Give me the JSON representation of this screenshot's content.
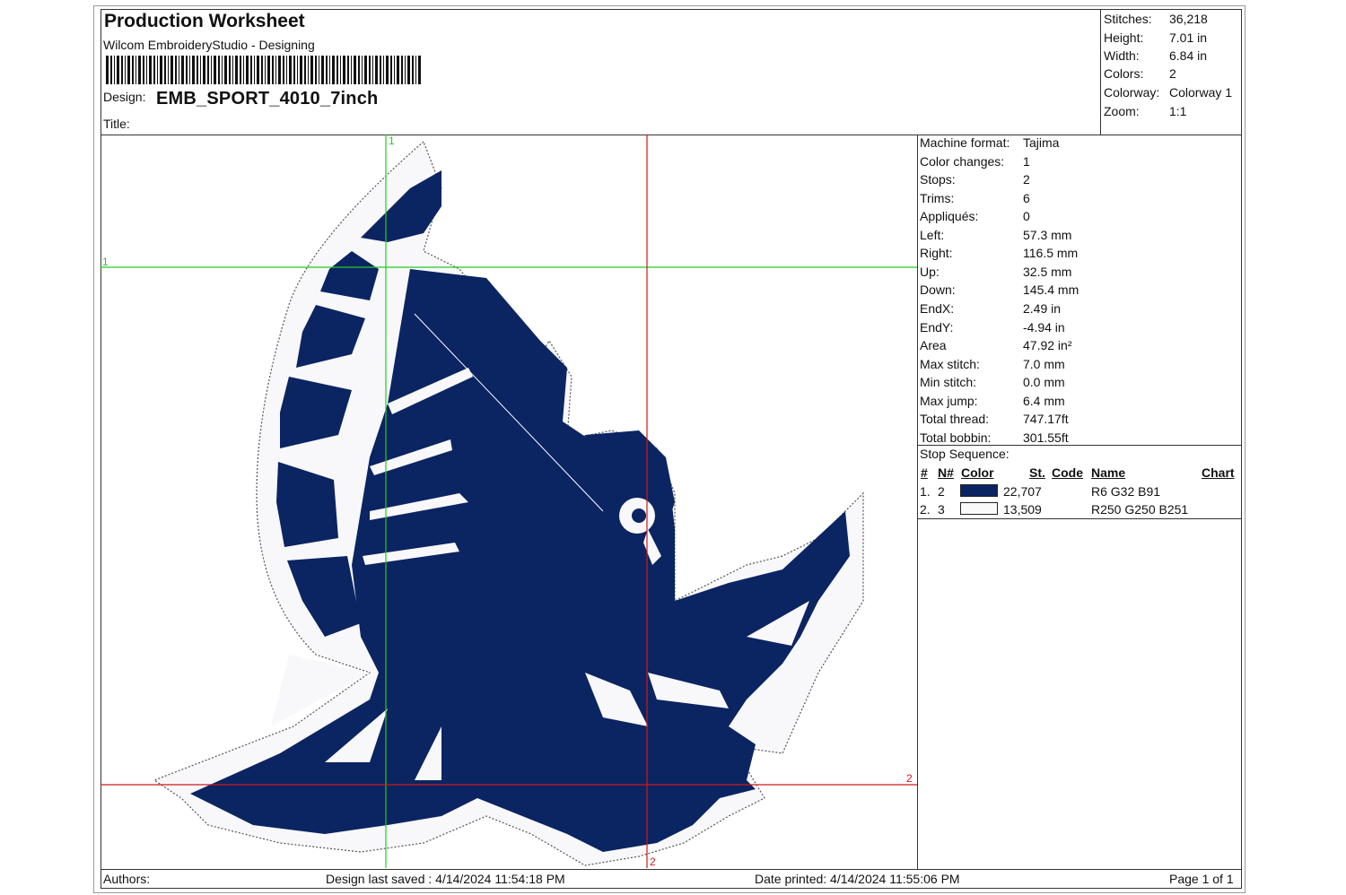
{
  "header": {
    "title": "Production Worksheet",
    "subtitle": "Wilcom EmbroideryStudio - Designing",
    "design_label": "Design:",
    "design_name": "EMB_SPORT_4010_7inch",
    "title_label": "Title:"
  },
  "summary": [
    {
      "k": "Stitches:",
      "v": "36,218"
    },
    {
      "k": "Height:",
      "v": "7.01 in"
    },
    {
      "k": "Width:",
      "v": "6.84 in"
    },
    {
      "k": "Colors:",
      "v": "2"
    },
    {
      "k": "Colorway:",
      "v": "Colorway 1"
    },
    {
      "k": "Zoom:",
      "v": "1:1"
    }
  ],
  "machine": [
    {
      "k": "Machine format:",
      "v": "Tajima"
    },
    {
      "k": "Color changes:",
      "v": "1"
    },
    {
      "k": "Stops:",
      "v": "2"
    },
    {
      "k": "Trims:",
      "v": "6"
    },
    {
      "k": "Appliqués:",
      "v": "0"
    },
    {
      "k": "Left:",
      "v": "57.3 mm"
    },
    {
      "k": "Right:",
      "v": "116.5 mm"
    },
    {
      "k": "Up:",
      "v": "32.5 mm"
    },
    {
      "k": "Down:",
      "v": "145.4 mm"
    },
    {
      "k": "EndX:",
      "v": "2.49 in"
    },
    {
      "k": "EndY:",
      "v": "-4.94 in"
    },
    {
      "k": "Area",
      "v": " 47.92 in²"
    },
    {
      "k": "Max stitch:",
      "v": "7.0 mm"
    },
    {
      "k": "Min stitch:",
      "v": "0.0 mm"
    },
    {
      "k": "Max jump:",
      "v": "6.4 mm"
    },
    {
      "k": "Total thread:",
      "v": "747.17ft"
    },
    {
      "k": "Total bobbin:",
      "v": "301.55ft"
    }
  ],
  "stop_sequence": {
    "label": "Stop Sequence:",
    "headers": {
      "num": "#",
      "n": "N#",
      "color": "Color",
      "st": "St.",
      "code": "Code",
      "name": "Name",
      "chart": "Chart"
    },
    "rows": [
      {
        "num": "1.",
        "n": "2",
        "swatch": "#0b2462",
        "st": "22,707",
        "name": "R6 G32 B91"
      },
      {
        "num": "2.",
        "n": "3",
        "swatch": "#fafafb",
        "st": "13,509",
        "name": "R250 G250 B251"
      }
    ]
  },
  "markers": {
    "green_h": "1",
    "green_v": "1",
    "red_h": "2",
    "red_v": "2"
  },
  "footer": {
    "authors": "Authors:",
    "saved": "Design last saved : 4/14/2024 11:54:18 PM",
    "printed": "Date printed: 4/14/2024 11:55:06 PM",
    "page": "Page 1 of 1"
  },
  "colors": {
    "thread_navy": "#0b2462",
    "thread_white": "#fafafb",
    "guide_green": "#22cc22",
    "guide_red": "#d01818"
  },
  "icons": [
    "barcode",
    "owl-embroidery-design"
  ]
}
